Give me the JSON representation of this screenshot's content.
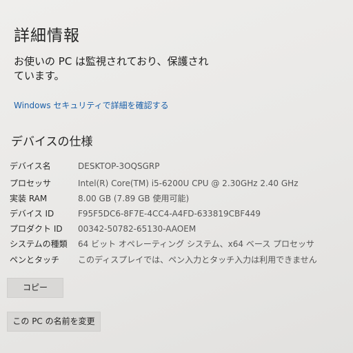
{
  "header": {
    "title": "詳細情報",
    "protection_line1": "お使いの PC は監視されており、保護され",
    "protection_line2": "ています。",
    "security_link": "Windows セキュリティで詳細を確認する"
  },
  "device_specs": {
    "heading": "デバイスの仕様",
    "rows": [
      {
        "label": "デバイス名",
        "value": "DESKTOP-3OQSGRP"
      },
      {
        "label": "プロセッサ",
        "value": "Intel(R) Core(TM) i5-6200U CPU @ 2.30GHz   2.40 GHz"
      },
      {
        "label": "実装 RAM",
        "value": "8.00 GB (7.89 GB 使用可能)"
      },
      {
        "label": "デバイス ID",
        "value": "F95F5DC6-8F7E-4CC4-A4FD-633819CBF449"
      },
      {
        "label": "プロダクト ID",
        "value": "00342-50782-65130-AAOEM"
      },
      {
        "label": "システムの種類",
        "value": "64 ビット オペレーティング システム、x64 ベース プロセッサ"
      },
      {
        "label": "ペンとタッチ",
        "value": "このディスプレイでは、ペン入力とタッチ入力は利用できません"
      }
    ]
  },
  "buttons": {
    "copy_label": "コピー",
    "rename_label": "この PC の名前を変更"
  },
  "colors": {
    "link": "#1a5fa8",
    "background": "#ebeae8",
    "button": "#d9d8d6"
  }
}
